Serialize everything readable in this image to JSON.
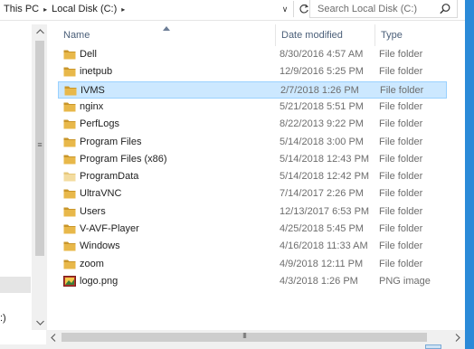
{
  "address": {
    "crumbs": [
      "This PC",
      "Local Disk (C:)"
    ],
    "separator": "▸",
    "dropdown_glyph": "∨",
    "refresh_glyph": "↻",
    "search_placeholder": "Search Local Disk (C:)"
  },
  "nav": {
    "fragment_text": ":)"
  },
  "columns": {
    "name": "Name",
    "date": "Date modified",
    "type": "Type"
  },
  "files": [
    {
      "name": "Dell",
      "date": "8/30/2016 4:57 AM",
      "type": "File folder",
      "icon": "folder-icon",
      "selected": false
    },
    {
      "name": "inetpub",
      "date": "12/9/2016 5:25 PM",
      "type": "File folder",
      "icon": "folder-icon",
      "selected": false
    },
    {
      "name": "IVMS",
      "date": "2/7/2018 1:26 PM",
      "type": "File folder",
      "icon": "folder-icon",
      "selected": true
    },
    {
      "name": "nginx",
      "date": "5/21/2018 5:51 PM",
      "type": "File folder",
      "icon": "folder-icon",
      "selected": false
    },
    {
      "name": "PerfLogs",
      "date": "8/22/2013 9:22 PM",
      "type": "File folder",
      "icon": "folder-icon",
      "selected": false
    },
    {
      "name": "Program Files",
      "date": "5/14/2018 3:00 PM",
      "type": "File folder",
      "icon": "folder-icon",
      "selected": false
    },
    {
      "name": "Program Files (x86)",
      "date": "5/14/2018 12:43 PM",
      "type": "File folder",
      "icon": "folder-icon",
      "selected": false
    },
    {
      "name": "ProgramData",
      "date": "5/14/2018 12:42 PM",
      "type": "File folder",
      "icon": "hidden-folder-icon",
      "selected": false
    },
    {
      "name": "UltraVNC",
      "date": "7/14/2017 2:26 PM",
      "type": "File folder",
      "icon": "folder-icon",
      "selected": false
    },
    {
      "name": "Users",
      "date": "12/13/2017 6:53 PM",
      "type": "File folder",
      "icon": "folder-icon",
      "selected": false
    },
    {
      "name": "V-AVF-Player",
      "date": "4/25/2018 5:45 PM",
      "type": "File folder",
      "icon": "folder-icon",
      "selected": false
    },
    {
      "name": "Windows",
      "date": "4/16/2018 11:33 AM",
      "type": "File folder",
      "icon": "folder-icon",
      "selected": false
    },
    {
      "name": "zoom",
      "date": "4/9/2018 12:11 PM",
      "type": "File folder",
      "icon": "folder-icon",
      "selected": false
    },
    {
      "name": "logo.png",
      "date": "4/3/2018 1:26 PM",
      "type": "PNG image",
      "icon": "image-file-icon",
      "selected": false
    }
  ],
  "scrollbar": {
    "grip_glyph": "≡",
    "hgrip_glyph": "III"
  },
  "colors": {
    "folder": "#e8b84a",
    "selection": "#cce8ff",
    "selection_border": "#99d1ff",
    "window_edge": "#2b8ad8"
  }
}
